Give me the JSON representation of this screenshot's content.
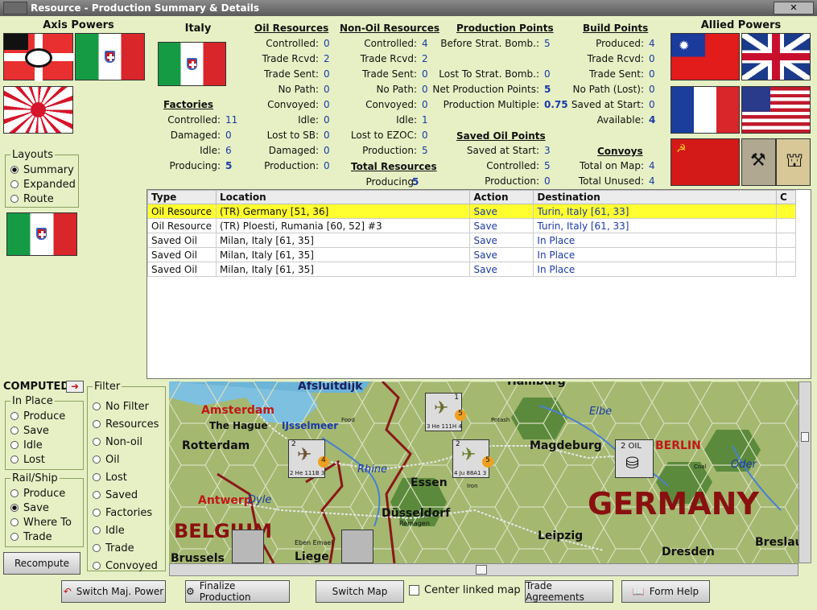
{
  "window": {
    "title": "Resource - Production Summary & Details"
  },
  "axis": {
    "label": "Axis Powers"
  },
  "allied": {
    "label": "Allied Powers"
  },
  "layouts": {
    "label": "Layouts",
    "options": [
      {
        "label": "Summary",
        "checked": true
      },
      {
        "label": "Expanded",
        "checked": false
      },
      {
        "label": "Route",
        "checked": false
      }
    ]
  },
  "country": {
    "name": "Italy"
  },
  "factories": {
    "title": "Factories",
    "rows": [
      [
        "Controlled:",
        "11"
      ],
      [
        "Damaged:",
        "0"
      ],
      [
        "Idle:",
        "6"
      ],
      [
        "Producing:",
        "5"
      ]
    ]
  },
  "oil": {
    "title": "Oil Resources",
    "rows": [
      [
        "Controlled:",
        "0"
      ],
      [
        "Trade Rcvd:",
        "2"
      ],
      [
        "Trade Sent:",
        "0"
      ],
      [
        "No Path:",
        "0"
      ],
      [
        "Convoyed:",
        "0"
      ],
      [
        "Idle:",
        "0"
      ],
      [
        "Lost to SB:",
        "0"
      ],
      [
        "Damaged:",
        "0"
      ],
      [
        "Production:",
        "0"
      ]
    ]
  },
  "nonoil": {
    "title": "Non-Oil Resources",
    "rows": [
      [
        "Controlled:",
        "4"
      ],
      [
        "Trade Rcvd:",
        "2"
      ],
      [
        "Trade Sent:",
        "0"
      ],
      [
        "No Path:",
        "0"
      ],
      [
        "Convoyed:",
        "0"
      ],
      [
        "Idle:",
        "1"
      ],
      [
        "Lost to EZOC:",
        "0"
      ],
      [
        "Production:",
        "5"
      ]
    ]
  },
  "total": {
    "title": "Total Resources",
    "label": "Producing:",
    "value": "5"
  },
  "pp": {
    "title": "Production Points",
    "rows": [
      [
        "Before Strat. Bomb.:",
        "5"
      ],
      [
        "Lost To Strat. Bomb.:",
        "0"
      ],
      [
        "Net Production Points:",
        "5"
      ],
      [
        "Production Multiple:",
        "0.75"
      ]
    ]
  },
  "savedoil": {
    "title": "Saved Oil Points",
    "rows": [
      [
        "Saved at Start:",
        "3"
      ],
      [
        "Controlled:",
        "5"
      ],
      [
        "Production:",
        "0"
      ]
    ]
  },
  "bp": {
    "title": "Build Points",
    "rows": [
      [
        "Produced:",
        "4"
      ],
      [
        "Trade Rcvd:",
        "0"
      ],
      [
        "Trade Sent:",
        "0"
      ],
      [
        "No Path (Lost):",
        "0"
      ],
      [
        "Saved at Start:",
        "0"
      ],
      [
        "Available:",
        "4"
      ]
    ]
  },
  "convoys": {
    "title": "Convoys",
    "rows": [
      [
        "Total on Map:",
        "4"
      ],
      [
        "Total Unused:",
        "4"
      ]
    ]
  },
  "table": {
    "headers": [
      "Type",
      "Location",
      "Action",
      "Destination",
      "C"
    ],
    "rows": [
      [
        "Oil Resource",
        "(TR) Germany [51, 36]",
        "Save",
        "Turin, Italy [61, 33]",
        ""
      ],
      [
        "Oil Resource",
        "(TR) Ploesti, Rumania [60, 52] #3",
        "Save",
        "Turin, Italy [61, 33]",
        ""
      ],
      [
        "Saved Oil",
        "Milan, Italy [61, 35]",
        "Save",
        "In Place",
        ""
      ],
      [
        "Saved Oil",
        "Milan, Italy [61, 35]",
        "Save",
        "In Place",
        ""
      ],
      [
        "Saved Oil",
        "Milan, Italy [61, 35]",
        "Save",
        "In Place",
        ""
      ]
    ]
  },
  "computed": {
    "label": "COMPUTED"
  },
  "inplace": {
    "label": "In Place",
    "options": [
      {
        "label": "Produce",
        "checked": false
      },
      {
        "label": "Save",
        "checked": false
      },
      {
        "label": "Idle",
        "checked": false
      },
      {
        "label": "Lost",
        "checked": false
      }
    ]
  },
  "railship": {
    "label": "Rail/Ship",
    "options": [
      {
        "label": "Produce",
        "checked": false
      },
      {
        "label": "Save",
        "checked": true
      },
      {
        "label": "Where To",
        "checked": false
      },
      {
        "label": "Trade",
        "checked": false
      }
    ]
  },
  "filter": {
    "label": "Filter",
    "options": [
      {
        "label": "No Filter",
        "checked": false
      },
      {
        "label": "Resources",
        "checked": false
      },
      {
        "label": "Non-oil",
        "checked": false
      },
      {
        "label": "Oil",
        "checked": false
      },
      {
        "label": "Lost",
        "checked": false
      },
      {
        "label": "Saved",
        "checked": false
      },
      {
        "label": "Factories",
        "checked": false
      },
      {
        "label": "Idle",
        "checked": false
      },
      {
        "label": "Trade",
        "checked": false
      },
      {
        "label": "Convoyed",
        "checked": false
      }
    ]
  },
  "recompute": {
    "label": "Recompute"
  },
  "map": {
    "labels": {
      "afsluitdijk": "Afsluitdijk",
      "amsterdam": "Amsterdam",
      "hague": "The Hague",
      "ijssel": "IJsselmeer",
      "rotterdam": "Rotterdam",
      "antwerp": "Antwerp",
      "dyle": "Dyle",
      "belgium": "BELGIUM",
      "brussels": "Brussels",
      "liege": "Liege",
      "rhine": "Rhine",
      "essen": "Essen",
      "dusseldorf": "Düsseldorf",
      "remagen": "Remagen",
      "eben": "Eben Emael",
      "elbe": "Elbe",
      "magdeburg": "Magdeburg",
      "berlin": "BERLIN",
      "oder": "Oder",
      "germany": "GERMANY",
      "leipzig": "Leipzig",
      "dresden": "Dresden",
      "breslau": "Breslau",
      "hamburg": "Hamburg",
      "food": "Food",
      "potash": "Potash",
      "coal": "Coal",
      "iron": "Iron",
      "oilstack": "2 OIL"
    },
    "units": [
      {
        "top": "1",
        "name": "3 He 111H 4",
        "badge": "5"
      },
      {
        "top": "2",
        "name": "2 He 111B 3",
        "badge": "4"
      },
      {
        "top": "2",
        "name": "4 Ju 88A1 3",
        "badge": "5"
      }
    ]
  },
  "buttons": {
    "switch_power": "Switch Maj. Power",
    "finalize": "Finalize Production",
    "switch_map": "Switch Map",
    "center_linked": "Center linked map",
    "trade": "Trade Agreements",
    "help": "Form Help"
  },
  "colors": {
    "panel": "#e6f0c4",
    "value": "#1a3aa8",
    "selected_row": "#ffff30",
    "city_red": "#c01818"
  }
}
